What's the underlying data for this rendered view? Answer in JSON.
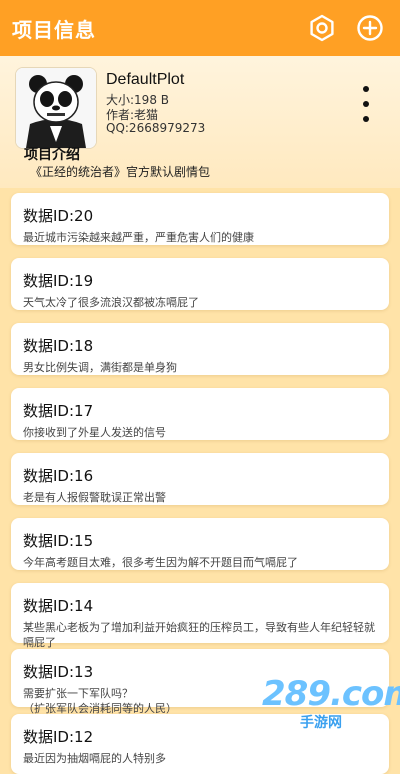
{
  "appbar": {
    "title": "项目信息",
    "icons": [
      "eye-settings-icon",
      "plus-circle-icon"
    ],
    "accent_color": "#ffa024"
  },
  "project": {
    "name": "DefaultPlot",
    "size": "大小:198 B",
    "author": "作者:老猫",
    "qq": "QQ:2668979273",
    "intro_title": "项目介绍",
    "intro_text": "《正经的统治者》官方默认剧情包"
  },
  "records": [
    {
      "id": "数据ID:20",
      "desc": "最近城市污染越来越严重，严重危害人们的健康"
    },
    {
      "id": "数据ID:19",
      "desc": "天气太冷了很多流浪汉都被冻嗝屁了"
    },
    {
      "id": "数据ID:18",
      "desc": "男女比例失调，满街都是单身狗"
    },
    {
      "id": "数据ID:17",
      "desc": "你接收到了外星人发送的信号"
    },
    {
      "id": "数据ID:16",
      "desc": "老是有人报假警耽误正常出警"
    },
    {
      "id": "数据ID:15",
      "desc": "今年高考题目太难，很多考生因为解不开题目而气嗝屁了"
    },
    {
      "id": "数据ID:14",
      "desc": "某些黑心老板为了增加利益开始疯狂的压榨员工，导致有些人年纪轻轻就嗝屁了"
    },
    {
      "id": "数据ID:13",
      "desc": "需要扩张一下军队吗？\n（扩张军队会消耗同等的人民）"
    },
    {
      "id": "数据ID:12",
      "desc": "最近因为抽烟嗝屁的人特别多"
    }
  ],
  "watermark": {
    "brand": "289.com",
    "sub": "手游网"
  }
}
